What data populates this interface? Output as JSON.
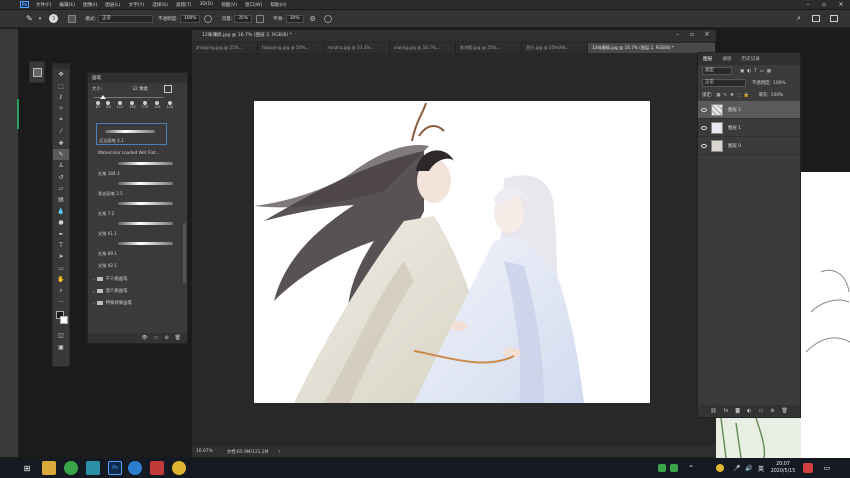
{
  "app": {
    "logo": "Ps",
    "menu": [
      "文件(F)",
      "编辑(E)",
      "图像(I)",
      "图层(L)",
      "文字(Y)",
      "选择(S)",
      "滤镜(T)",
      "3D(D)",
      "视图(V)",
      "窗口(W)",
      "帮助(H)"
    ]
  },
  "options": {
    "brush_size": "5",
    "mode_label": "模式:",
    "mode_value": "正常",
    "opacity_label": "不透明度:",
    "opacity_value": "100%",
    "flow_label": "流量:",
    "flow_value": "35%",
    "smooth_label": "平滑:",
    "smooth_value": "30%"
  },
  "document": {
    "title": "12咏珊搞.jpg @ 16.7% (图层 2, RGB/8) *",
    "tabs": [
      {
        "label": "zhiqiying.jpg @ 25%..."
      },
      {
        "label": "faqiuying.jpg @ 50%..."
      },
      {
        "label": "renzhu.jpg @ 33.3%..."
      },
      {
        "label": "xiuling.jpg @ 16.7%..."
      },
      {
        "label": "陈鸿熙.jpg @ 25%..."
      },
      {
        "label": "西行.jpg @ 25%(R6..."
      },
      {
        "label": "12咏珊搞.jpg @ 16.7% (图层 2, RGB/8) *"
      }
    ],
    "zoom": "16.67%",
    "doc_info": "文档:65.9M/121.2M"
  },
  "brush_panel": {
    "title": "画笔",
    "size_label": "大小:",
    "size_value": "32 像素",
    "preset_sizes": [
      "87",
      "63",
      "117",
      "155",
      "175",
      "125",
      "124"
    ],
    "brushes": [
      {
        "name": "买达画笔 4.1"
      },
      {
        "name": "Watercolor Loaded Wet Flat..."
      },
      {
        "name": "尖角 184.3"
      },
      {
        "name": "柔丝画笔 2.5"
      },
      {
        "name": "尖角 7.2"
      },
      {
        "name": "尖角 61.1"
      },
      {
        "name": "尖角 89.1"
      },
      {
        "name": "尖角 92.1"
      }
    ],
    "folders": [
      {
        "name": "干介质画笔"
      },
      {
        "name": "湿介质画笔"
      },
      {
        "name": "特殊效果画笔"
      }
    ]
  },
  "layers_panel": {
    "tabs": [
      "图层",
      "通道",
      "历史记录"
    ],
    "filter_label": "类型",
    "blend_mode": "正常",
    "opacity_label": "不透明度:",
    "opacity_value": "100%",
    "lock_label": "锁定:",
    "fill_label": "填充:",
    "fill_value": "100%",
    "layers": [
      {
        "name": "图层 2",
        "selected": true
      },
      {
        "name": "图层 1",
        "selected": false
      },
      {
        "name": "图层 0",
        "selected": false
      }
    ]
  },
  "taskbar": {
    "time": "20:07",
    "date": "2020/5/15"
  }
}
